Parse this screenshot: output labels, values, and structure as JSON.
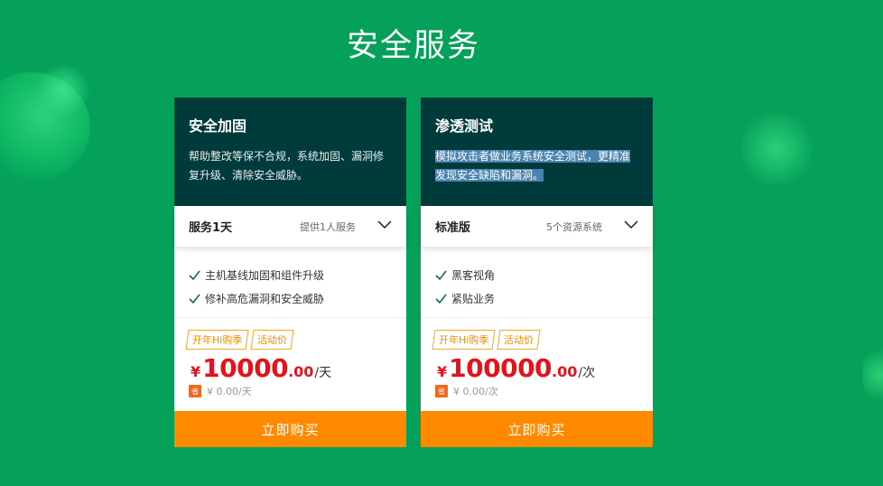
{
  "page": {
    "title": "安全服务"
  },
  "cards": [
    {
      "title": "安全加固",
      "desc": "帮助整改等保不合规，系统加固、漏洞修复升级、清除安全威胁。",
      "selector": {
        "label": "服务1天",
        "sub": "提供1人服务",
        "icon": "chevron-down-icon"
      },
      "features": [
        "主机基线加固和组件升级",
        "修补高危漏洞和安全威胁"
      ],
      "tags": [
        "开年Hi购季",
        "活动价"
      ],
      "price": {
        "currency": "¥",
        "amount": "10000",
        "decimal": ".00",
        "unit": "/天"
      },
      "original": {
        "badge": "省",
        "text": "¥ 0.00/天"
      },
      "buy_label": "立即购买"
    },
    {
      "title": "渗透测试",
      "desc": "模拟攻击者做业务系统安全测试，更精准发现安全缺陷和漏洞。",
      "selector": {
        "label": "标准版",
        "sub": "5个资源系统",
        "icon": "chevron-down-icon"
      },
      "features": [
        "黑客视角",
        "紧贴业务"
      ],
      "tags": [
        "开年Hi购季",
        "活动价"
      ],
      "price": {
        "currency": "¥",
        "amount": "100000",
        "decimal": ".00",
        "unit": "/次"
      },
      "original": {
        "badge": "省",
        "text": "¥ 0.00/次"
      },
      "buy_label": "立即购买"
    }
  ],
  "colors": {
    "background": "#05a15a",
    "card_header": "#003b3c",
    "price": "#e6121b",
    "buy_button": "#ff8a00",
    "tag": "#f08d00",
    "check": "#0d6b57"
  }
}
